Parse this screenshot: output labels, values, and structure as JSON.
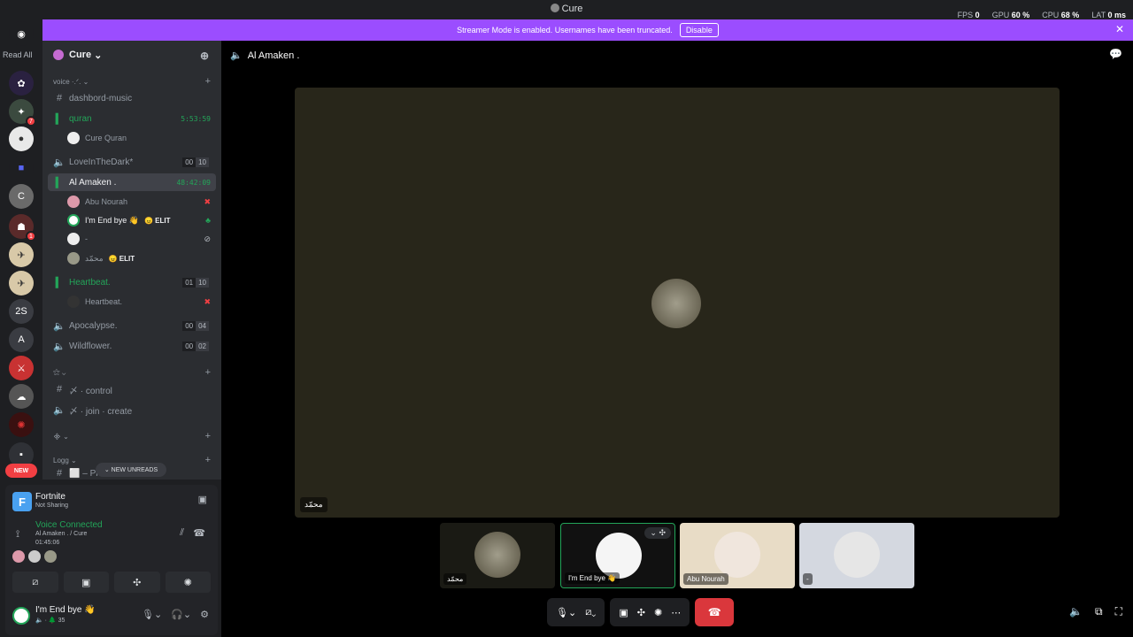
{
  "window": {
    "title": "Cure"
  },
  "stats": [
    {
      "label": "FPS",
      "value": "0"
    },
    {
      "label": "GPU",
      "value": "60 %"
    },
    {
      "label": "CPU",
      "value": "68 %"
    },
    {
      "label": "LAT",
      "value": "0 ms"
    }
  ],
  "banner": {
    "text": "Streamer Mode is enabled. Usernames have been truncated.",
    "button": "Disable"
  },
  "guildbar": {
    "read_all": "Read All",
    "new_label": "NEW",
    "guild_2s": "2S",
    "guild_a": "A",
    "badge_1": "7",
    "badge_2": "1"
  },
  "server": {
    "name": "Cure"
  },
  "categories": [
    {
      "label": "voice ·.ᐟ. ⌄"
    },
    {
      "label": "⚝ ⌄"
    },
    {
      "label": "᯽ ⌄"
    },
    {
      "label": "Logg ⌄"
    }
  ],
  "channels": [
    {
      "name": "dashbord-music",
      "type": "text"
    },
    {
      "name": "quran",
      "type": "voice",
      "time": "5:53:59"
    },
    {
      "name": "LoveInTheDark*",
      "type": "voice",
      "count_a": "00",
      "count_b": "10"
    },
    {
      "name": "Al Amaken .",
      "type": "voice",
      "time": "48:42:09"
    },
    {
      "name": "Heartbeat.",
      "type": "voice",
      "count_a": "01",
      "count_b": "10"
    },
    {
      "name": "Apocalypse.",
      "type": "voice",
      "count_a": "00",
      "count_b": "04"
    },
    {
      "name": "Wildflower.",
      "type": "voice",
      "count_a": "00",
      "count_b": "02"
    },
    {
      "name": "〆 · control",
      "type": "text"
    },
    {
      "name": "〆 · join · create",
      "type": "voice"
    },
    {
      "name": "⬜ – Private-Chat",
      "type": "text"
    }
  ],
  "voice_users": [
    {
      "name": "Cure Quran"
    },
    {
      "name": "Abu Nourah"
    },
    {
      "name": "I'm End bye 👋",
      "tag": "😠 ELIT"
    },
    {
      "name": "-"
    },
    {
      "name": "محمّد",
      "tag": "😠 ELIT"
    },
    {
      "name": "Heartbeat."
    }
  ],
  "new_unreads": "⌄ NEW UNREADS",
  "activity": {
    "app": "Fortnite",
    "status": "Not Sharing",
    "app_letter": "F"
  },
  "voice_status": {
    "title": "Voice Connected",
    "channel": "Al Amaken . / Cure",
    "time": "01:45:06"
  },
  "me": {
    "name": "I'm End bye 👋",
    "status": "🔈 · 🌲 35"
  },
  "main": {
    "channel": "Al Amaken .",
    "stage_label": "محمّد"
  },
  "tiles": [
    {
      "label": "محمّد"
    },
    {
      "label": "I'm End bye 👋"
    },
    {
      "label": "Abu Nourah"
    },
    {
      "label": "-"
    }
  ],
  "icons": {
    "speaker": "speaker-icon",
    "mic": "microphone-icon",
    "camera": "camera-off-icon",
    "share": "screen-share-icon",
    "activity": "activity-icon",
    "soundboard": "soundboard-icon",
    "more": "more-icon",
    "end": "end-call-icon"
  }
}
